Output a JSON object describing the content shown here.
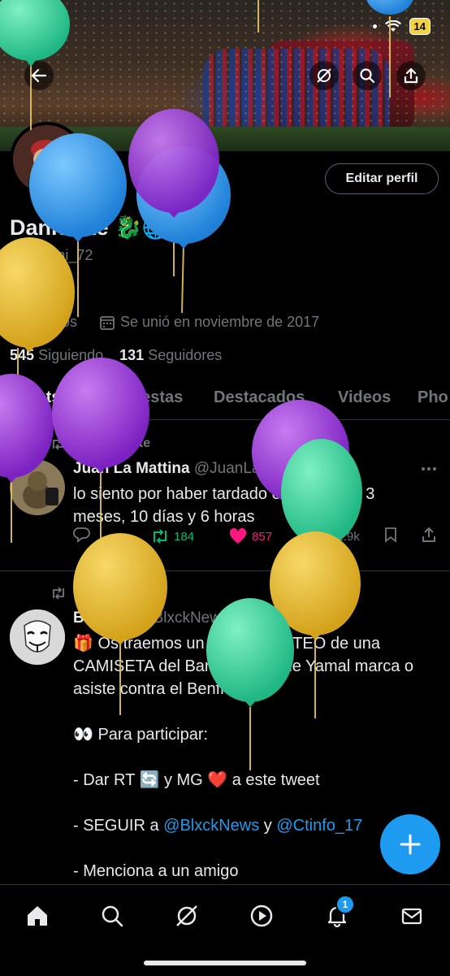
{
  "status_bar": {
    "time": "9:40",
    "battery": "14"
  },
  "header": {
    "back": "back-arrow",
    "actions": [
      "grok-icon",
      "search-icon",
      "share-icon"
    ]
  },
  "profile": {
    "edit_label": "Editar perfil",
    "name": "Danielote 🐉🌐",
    "handle": "@daaani_72",
    "hearts": "🧡💛",
    "location": "Burgos",
    "joined": "Se unió en noviembre de 2017",
    "following_count": "545",
    "following_label": "Siguiendo",
    "followers_count": "131",
    "followers_label": "Seguidores"
  },
  "tabs": [
    {
      "label": "Posts",
      "active": true
    },
    {
      "label": "Respuestas"
    },
    {
      "label": "Destacados"
    },
    {
      "label": "Videos"
    },
    {
      "label": "Pho"
    }
  ],
  "posts": [
    {
      "repost_label": "Reposteaste",
      "name": "Juan La Mattina",
      "handle": "@JuanLa",
      "date": "· 14/3/25",
      "body": "lo siento por haber tardado en contestar 3 meses, 10 días y 6 horas",
      "retweets": "184",
      "likes": "857",
      "views": "22.9k"
    },
    {
      "repost_label": "Reposteaste",
      "name": "Black",
      "handle": "@BlxckNews",
      "date": "· 4/3/25",
      "line1": "🎁 Os traemos un nuevo SORTEO de una CAMISETA del Barça si Lamine Yamal marca o asiste contra el Benfica 🤯",
      "line2": "👀 Para participar:",
      "line3": "- Dar RT 🔄 y MG ❤️ a este tweet",
      "line4_prefix": "- SEGUIR a ",
      "line4_link1": "@BlxckNews",
      "line4_mid": " y ",
      "line4_link2": "@Ctinfo_17",
      "line5": "- Menciona a un amigo"
    }
  ],
  "nav": {
    "notifications_badge": "1"
  },
  "colors": {
    "accent": "#1d9bf0",
    "like": "#f91880",
    "retweet": "#00ba7c"
  }
}
